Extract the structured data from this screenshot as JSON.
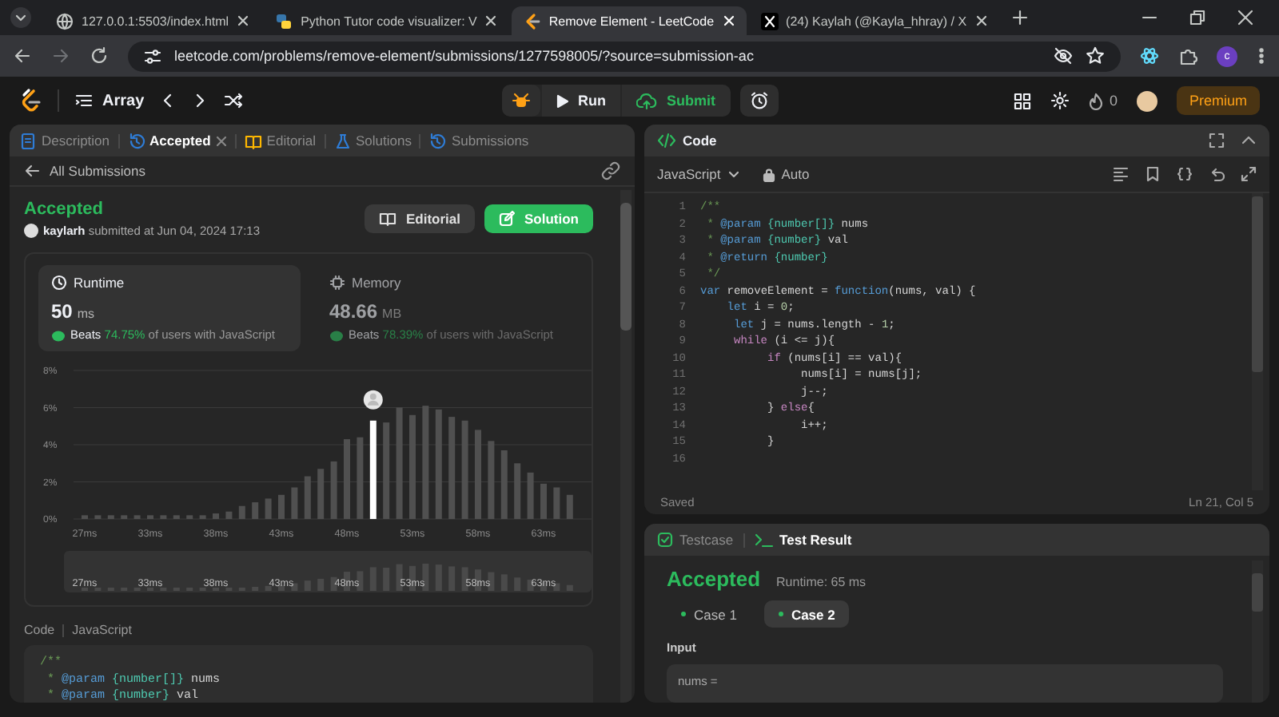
{
  "browser": {
    "tabs": [
      {
        "title": "127.0.0.1:5503/index.html",
        "selected": false
      },
      {
        "title": "Python Tutor code visualizer: V",
        "selected": false
      },
      {
        "title": "Remove Element - LeetCode",
        "selected": true
      },
      {
        "title": "(24) Kaylah (@Kayla_hhray) / X",
        "selected": false
      }
    ],
    "url": "leetcode.com/problems/remove-element/submissions/1277598005/?source=submission-ac",
    "profile": "c"
  },
  "nav": {
    "problem_list": "Array",
    "run": "Run",
    "submit": "Submit",
    "streak": "0",
    "premium": "Premium"
  },
  "left": {
    "tabs": [
      {
        "label": "Description",
        "selected": false,
        "closable": false
      },
      {
        "label": "Accepted",
        "selected": true,
        "closable": true
      },
      {
        "label": "Editorial",
        "selected": false,
        "closable": false
      },
      {
        "label": "Solutions",
        "selected": false,
        "closable": false
      },
      {
        "label": "Submissions",
        "selected": false,
        "closable": false
      }
    ],
    "back_link": "All Submissions",
    "status": "Accepted",
    "author": "kaylarh",
    "submitted": "submitted at Jun 04, 2024 17:13",
    "buttons": [
      {
        "label": "Editorial",
        "kind": "secondary"
      },
      {
        "label": "Solution",
        "kind": "primary"
      }
    ],
    "stats": [
      {
        "title": "Runtime",
        "value": "50",
        "unit": "ms",
        "beats_label": "Beats",
        "beats": "74.75%",
        "beats_suffix": "of users with JavaScript",
        "selected": true
      },
      {
        "title": "Memory",
        "value": "48.66",
        "unit": "MB",
        "beats_label": "Beats",
        "beats": "78.39%",
        "beats_suffix": "of users with JavaScript",
        "selected": false
      }
    ],
    "chart_data": {
      "type": "bar",
      "categories": [
        "27ms",
        null,
        null,
        null,
        null,
        "33ms",
        null,
        null,
        null,
        null,
        "38ms",
        null,
        null,
        null,
        null,
        "43ms",
        null,
        null,
        null,
        null,
        "48ms",
        null,
        null,
        null,
        null,
        "53ms",
        null,
        null,
        null,
        null,
        "58ms",
        null,
        null,
        null,
        null,
        "63ms",
        null,
        null
      ],
      "series": [
        {
          "color": "#505050",
          "values": [
            0.2,
            0.2,
            0.2,
            0.2,
            0.2,
            0.2,
            0.2,
            0.2,
            0.2,
            0.2,
            0.3,
            0.4,
            0.7,
            0.9,
            1.1,
            1.3,
            1.7,
            2.3,
            2.7,
            3.1,
            4.3,
            4.4,
            null,
            5.2,
            6.0,
            5.6,
            6.1,
            5.9,
            5.5,
            5.3,
            4.8,
            4.2,
            3.7,
            3.0,
            2.5,
            1.9,
            1.7,
            1.3
          ]
        },
        {
          "color": "#ffffff",
          "values": [
            null,
            null,
            null,
            null,
            null,
            null,
            null,
            null,
            null,
            null,
            null,
            null,
            null,
            null,
            null,
            null,
            null,
            null,
            null,
            null,
            null,
            null,
            5.3,
            null,
            null,
            null,
            null,
            null,
            null,
            null,
            null,
            null,
            null,
            null,
            null,
            null,
            null,
            null
          ]
        }
      ],
      "grid": true,
      "ylim": [
        0,
        8
      ],
      "yticks": [
        {
          "value": 0,
          "label": "0%"
        },
        {
          "value": 2,
          "label": "2%"
        },
        {
          "value": 4,
          "label": "4%"
        },
        {
          "value": 6,
          "label": "6%"
        },
        {
          "value": 8,
          "label": "8%"
        }
      ]
    },
    "overview_labels": [
      "27ms",
      "33ms",
      "38ms",
      "43ms",
      "48ms",
      "53ms",
      "58ms",
      "63ms"
    ],
    "code_title": "Code",
    "code_language": "JavaScript",
    "code_lines": [
      {
        "tokens": [
          {
            "kind": "comment",
            "text": "/**"
          }
        ]
      },
      {
        "tokens": [
          {
            "kind": "comment",
            "text": " *"
          },
          {
            "kind": "tag",
            "text": " @param"
          },
          {
            "kind": "type",
            "text": " {number[]}"
          },
          {
            "kind": "plain",
            "text": " nums"
          }
        ]
      },
      {
        "tokens": [
          {
            "kind": "comment",
            "text": " *"
          },
          {
            "kind": "tag",
            "text": " @param"
          },
          {
            "kind": "type",
            "text": " {number}"
          },
          {
            "kind": "plain",
            "text": " val"
          }
        ]
      }
    ]
  },
  "editor": {
    "title": "Code",
    "language": "JavaScript",
    "mode": "Auto",
    "lines": [
      {
        "number": "1",
        "tokens": [
          {
            "kind": "comment",
            "text": "/**"
          }
        ]
      },
      {
        "number": "2",
        "tokens": [
          {
            "kind": "comment",
            "text": " *"
          },
          {
            "kind": "tag",
            "text": " @param"
          },
          {
            "kind": "type",
            "text": " {number[]}"
          },
          {
            "kind": "plain",
            "text": " nums"
          }
        ]
      },
      {
        "number": "3",
        "tokens": [
          {
            "kind": "comment",
            "text": " *"
          },
          {
            "kind": "tag",
            "text": " @param"
          },
          {
            "kind": "type",
            "text": " {number}"
          },
          {
            "kind": "plain",
            "text": " val"
          }
        ]
      },
      {
        "number": "4",
        "tokens": [
          {
            "kind": "comment",
            "text": " *"
          },
          {
            "kind": "tag",
            "text": " @return"
          },
          {
            "kind": "type",
            "text": " {number}"
          }
        ]
      },
      {
        "number": "5",
        "tokens": [
          {
            "kind": "comment",
            "text": " */"
          }
        ]
      },
      {
        "number": "6",
        "tokens": [
          {
            "kind": "keyword",
            "text": "var"
          },
          {
            "kind": "plain",
            "text": " removeElement = "
          },
          {
            "kind": "keyword",
            "text": "function"
          },
          {
            "kind": "plain",
            "text": "(nums, val) {"
          }
        ]
      },
      {
        "number": "7",
        "tokens": [
          {
            "kind": "keyword",
            "text": "    let"
          },
          {
            "kind": "plain",
            "text": " i = "
          },
          {
            "kind": "number",
            "text": "0"
          },
          {
            "kind": "plain",
            "text": ";"
          }
        ]
      },
      {
        "number": "8",
        "tokens": [
          {
            "kind": "keyword",
            "text": "     let"
          },
          {
            "kind": "plain",
            "text": " j = nums.length - "
          },
          {
            "kind": "number",
            "text": "1"
          },
          {
            "kind": "plain",
            "text": ";"
          }
        ]
      },
      {
        "number": "9",
        "tokens": [
          {
            "kind": "control",
            "text": "     while"
          },
          {
            "kind": "plain",
            "text": " (i <= j){"
          }
        ]
      },
      {
        "number": "10",
        "tokens": [
          {
            "kind": "control",
            "text": "          if"
          },
          {
            "kind": "plain",
            "text": " (nums[i] == val){"
          }
        ]
      },
      {
        "number": "11",
        "tokens": [
          {
            "kind": "plain",
            "text": "               nums[i] = nums[j];"
          }
        ]
      },
      {
        "number": "12",
        "tokens": [
          {
            "kind": "plain",
            "text": "               j--;"
          }
        ]
      },
      {
        "number": "13",
        "tokens": [
          {
            "kind": "plain",
            "text": "          } "
          },
          {
            "kind": "control",
            "text": "else"
          },
          {
            "kind": "plain",
            "text": "{"
          }
        ]
      },
      {
        "number": "14",
        "tokens": [
          {
            "kind": "plain",
            "text": "               i++;"
          }
        ]
      },
      {
        "number": "15",
        "tokens": [
          {
            "kind": "plain",
            "text": "          }"
          }
        ]
      },
      {
        "number": "16"
      }
    ],
    "status": "Saved",
    "cursor": "Ln 21, Col 5"
  },
  "result": {
    "tabs": [
      {
        "label": "Testcase",
        "selected": false
      },
      {
        "label": "Test Result",
        "selected": true
      }
    ],
    "verdict": "Accepted",
    "runtime": "Runtime: 65 ms",
    "cases": [
      {
        "label": "Case 1",
        "selected": false
      },
      {
        "label": "Case 2",
        "selected": true
      }
    ],
    "input_label": "Input",
    "input_value": "nums ="
  }
}
